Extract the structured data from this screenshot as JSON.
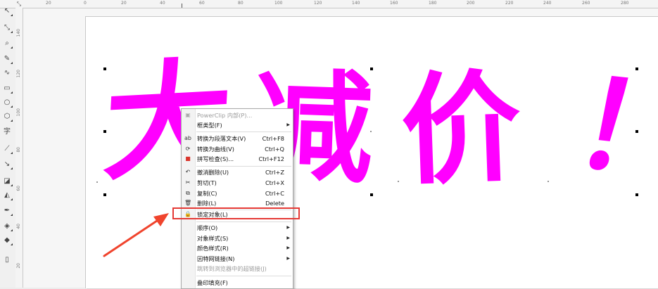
{
  "ruler_top": [
    "20",
    "0",
    "20",
    "40",
    "60",
    "80",
    "100",
    "120",
    "140",
    "160",
    "180",
    "200",
    "220",
    "240",
    "260",
    "280"
  ],
  "ruler_left": [
    "140",
    "120",
    "100",
    "80",
    "60",
    "40",
    "20"
  ],
  "canvas_text": {
    "chars": [
      "大",
      "减",
      "价",
      "！"
    ],
    "color": "#ff00ff"
  },
  "context_menu": {
    "items": [
      {
        "icon": "powerclip-icon",
        "label": "PowerClip 内部(P)...",
        "shortcut": "",
        "submenu": false,
        "disabled": true
      },
      {
        "icon": "",
        "label": "框类型(F)",
        "shortcut": "",
        "submenu": true,
        "disabled": false
      },
      {
        "icon": "paragraph-text-icon",
        "label": "转换为段落文本(V)",
        "shortcut": "Ctrl+F8",
        "submenu": false,
        "disabled": false
      },
      {
        "icon": "curve-icon",
        "label": "转换为曲线(V)",
        "shortcut": "Ctrl+Q",
        "submenu": false,
        "disabled": false
      },
      {
        "icon": "spellcheck-icon",
        "label": "拼写检查(S)...",
        "shortcut": "Ctrl+F12",
        "submenu": false,
        "disabled": false
      },
      {
        "icon": "undo-icon",
        "label": "撤消删除(U)",
        "shortcut": "Ctrl+Z",
        "submenu": false,
        "disabled": false
      },
      {
        "icon": "scissors-icon",
        "label": "剪切(T)",
        "shortcut": "Ctrl+X",
        "submenu": false,
        "disabled": false
      },
      {
        "icon": "copy-icon",
        "label": "复制(C)",
        "shortcut": "Ctrl+C",
        "submenu": false,
        "disabled": false
      },
      {
        "icon": "trash-icon",
        "label": "删除(L)",
        "shortcut": "Delete",
        "submenu": false,
        "disabled": false
      },
      {
        "icon": "lock-icon",
        "label": "锁定对象(L)",
        "shortcut": "",
        "submenu": false,
        "disabled": false
      },
      {
        "icon": "",
        "label": "顺序(O)",
        "shortcut": "",
        "submenu": true,
        "disabled": false
      },
      {
        "icon": "",
        "label": "对象样式(S)",
        "shortcut": "",
        "submenu": true,
        "disabled": false
      },
      {
        "icon": "",
        "label": "颜色样式(R)",
        "shortcut": "",
        "submenu": true,
        "disabled": false
      },
      {
        "icon": "",
        "label": "因特网链接(N)",
        "shortcut": "",
        "submenu": true,
        "disabled": false
      },
      {
        "icon": "",
        "label": "跳转到浏览器中的超链接(J)",
        "shortcut": "",
        "submenu": false,
        "disabled": true
      },
      {
        "icon": "",
        "label": "叠印填充(F)",
        "shortcut": "",
        "submenu": false,
        "disabled": false
      }
    ]
  },
  "colors": {
    "highlight": "#e53935",
    "accent": "#ff00ff"
  }
}
